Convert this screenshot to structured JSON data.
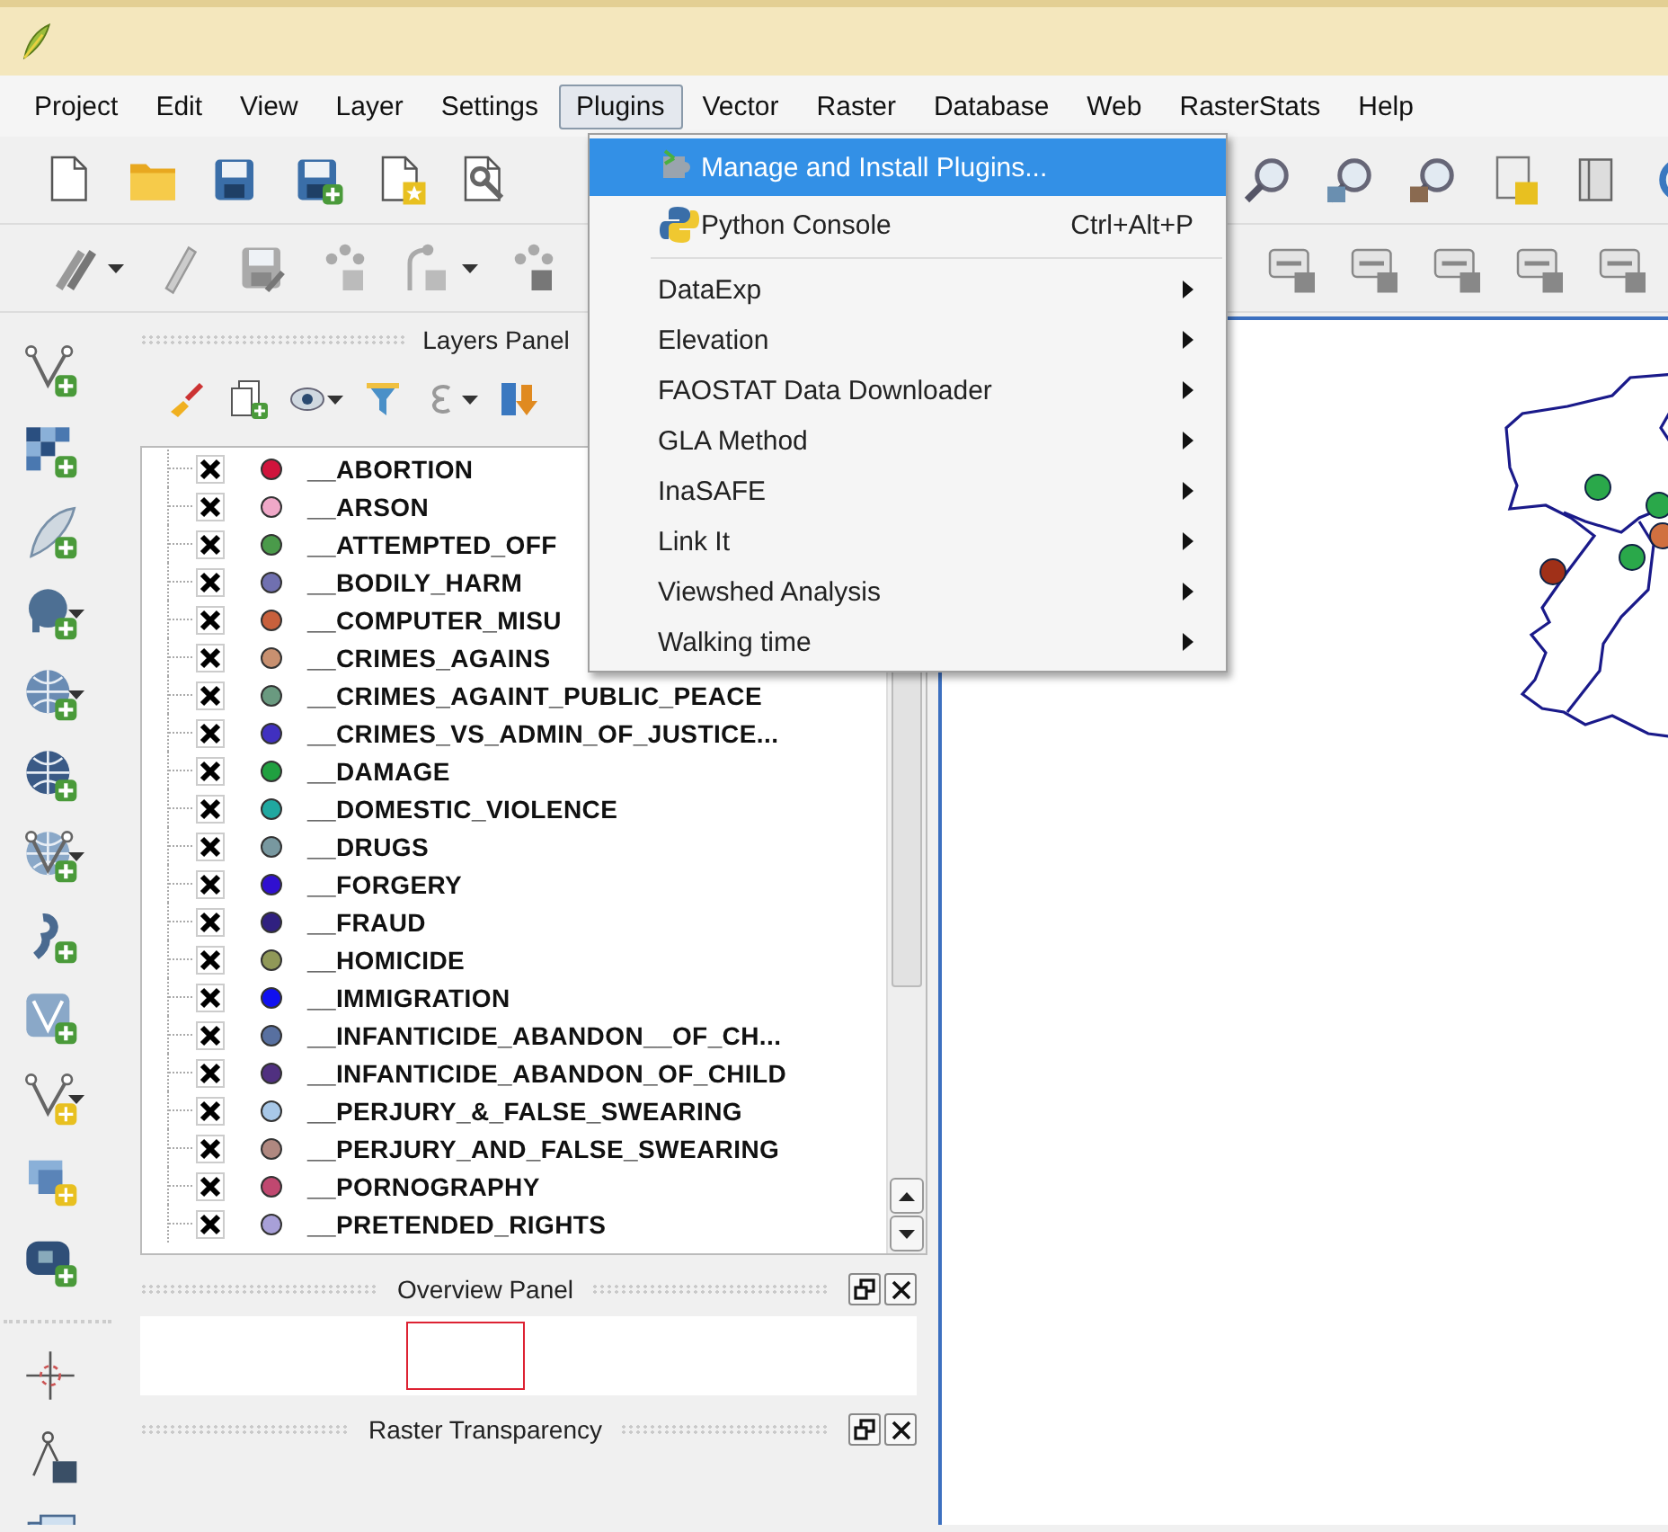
{
  "menu_bar": [
    {
      "label": "Project",
      "selected": false
    },
    {
      "label": "Edit",
      "selected": false
    },
    {
      "label": "View",
      "selected": false
    },
    {
      "label": "Layer",
      "selected": false
    },
    {
      "label": "Settings",
      "selected": false
    },
    {
      "label": "Plugins",
      "selected": true
    },
    {
      "label": "Vector",
      "selected": false
    },
    {
      "label": "Raster",
      "selected": false
    },
    {
      "label": "Database",
      "selected": false
    },
    {
      "label": "Web",
      "selected": false
    },
    {
      "label": "RasterStats",
      "selected": false
    },
    {
      "label": "Help",
      "selected": false
    }
  ],
  "plugins_menu": [
    {
      "kind": "action",
      "label": "Manage and Install Plugins...",
      "selected": true
    },
    {
      "kind": "action",
      "label": "Python Console",
      "shortcut": "Ctrl+Alt+P",
      "selected": false
    },
    {
      "kind": "separator"
    },
    {
      "kind": "submenu",
      "label": "DataExp",
      "selected": false
    },
    {
      "kind": "submenu",
      "label": "Elevation",
      "selected": false
    },
    {
      "kind": "submenu",
      "label": "FAOSTAT Data Downloader",
      "selected": false
    },
    {
      "kind": "submenu",
      "label": "GLA Method",
      "selected": false
    },
    {
      "kind": "submenu",
      "label": "InaSAFE",
      "selected": false
    },
    {
      "kind": "submenu",
      "label": "Link It",
      "selected": false
    },
    {
      "kind": "submenu",
      "label": "Viewshed Analysis",
      "selected": false
    },
    {
      "kind": "submenu",
      "label": "Walking time",
      "selected": false
    }
  ],
  "layers_panel": {
    "title": "Layers Panel",
    "layers": [
      {
        "name": "__ABORTION",
        "checked": true,
        "color": "#d0143c"
      },
      {
        "name": "__ARSON",
        "checked": true,
        "color": "#f0a8c8"
      },
      {
        "name": "__ATTEMPTED_OFF",
        "checked": true,
        "color": "#4a9a4a"
      },
      {
        "name": "__BODILY_HARM",
        "checked": true,
        "color": "#7070b0"
      },
      {
        "name": "__COMPUTER_MISU",
        "checked": true,
        "color": "#c8603c"
      },
      {
        "name": "__CRIMES_AGAINS",
        "checked": true,
        "color": "#c89070"
      },
      {
        "name": "__CRIMES_AGAINT_PUBLIC_PEACE",
        "checked": true,
        "color": "#6a9a80"
      },
      {
        "name": "__CRIMES_VS_ADMIN_OF_JUSTICE...",
        "checked": true,
        "color": "#4030c0"
      },
      {
        "name": "__DAMAGE",
        "checked": true,
        "color": "#20a040"
      },
      {
        "name": "__DOMESTIC_VIOLENCE",
        "checked": true,
        "color": "#20a8a0"
      },
      {
        "name": "__DRUGS",
        "checked": true,
        "color": "#7898a0"
      },
      {
        "name": "__FORGERY",
        "checked": true,
        "color": "#3010d0"
      },
      {
        "name": "__FRAUD",
        "checked": true,
        "color": "#302080"
      },
      {
        "name": "__HOMICIDE",
        "checked": true,
        "color": "#909858"
      },
      {
        "name": "__IMMIGRATION",
        "checked": true,
        "color": "#1010f0"
      },
      {
        "name": "__INFANTICIDE_ABANDON__OF_CH...",
        "checked": true,
        "color": "#5870a0"
      },
      {
        "name": "__INFANTICIDE_ABANDON_OF_CHILD",
        "checked": true,
        "color": "#503080"
      },
      {
        "name": "__PERJURY_&_FALSE_SWEARING",
        "checked": true,
        "color": "#a8c8e8"
      },
      {
        "name": "__PERJURY_AND_FALSE_SWEARING",
        "checked": true,
        "color": "#b08880"
      },
      {
        "name": "__PORNOGRAPHY",
        "checked": true,
        "color": "#c04870"
      },
      {
        "name": "__PRETENDED_RIGHTS",
        "checked": true,
        "color": "#a8a0d8"
      }
    ]
  },
  "overview_panel": {
    "title": "Overview Panel"
  },
  "raster_transparency_panel": {
    "title": "Raster Transparency"
  }
}
